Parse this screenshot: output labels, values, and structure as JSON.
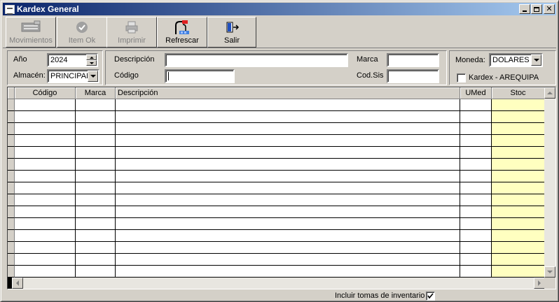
{
  "window": {
    "title": "Kardex General",
    "icon": "app-icon",
    "controls": [
      "minimize",
      "maximize",
      "close"
    ]
  },
  "toolbar": {
    "buttons": [
      {
        "label": "Movimientos",
        "icon": "movements-icon",
        "enabled": false
      },
      {
        "label": "Item Ok",
        "icon": "check-icon",
        "enabled": false
      },
      {
        "label": "Imprimir",
        "icon": "printer-icon",
        "enabled": false
      },
      {
        "label": "Refrescar",
        "icon": "refresh-icon",
        "enabled": true
      },
      {
        "label": "Salir",
        "icon": "exit-door-icon",
        "enabled": true
      }
    ]
  },
  "filters": {
    "anio_label": "Año",
    "anio_value": "2024",
    "almacen_label": "Almacén:",
    "almacen_value": "PRINCIPAL",
    "descripcion_label": "Descripción",
    "descripcion_value": "",
    "codigo_label": "Código",
    "codigo_value": "",
    "marca_label": "Marca",
    "marca_value": "",
    "codsis_label": "Cod.Sis",
    "codsis_value": "",
    "moneda_label": "Moneda:",
    "moneda_value": "DOLARES",
    "kardex_label": "Kardex - AREQUIPA",
    "kardex_checked": false
  },
  "grid": {
    "columns": [
      "Código",
      "Marca",
      "Descripción",
      "UMed",
      "Stoc"
    ],
    "row_count": 15,
    "highlight_color": "#ffffc0"
  },
  "footer": {
    "incluir_label": "Incluir tomas de inventario",
    "incluir_checked": true
  }
}
